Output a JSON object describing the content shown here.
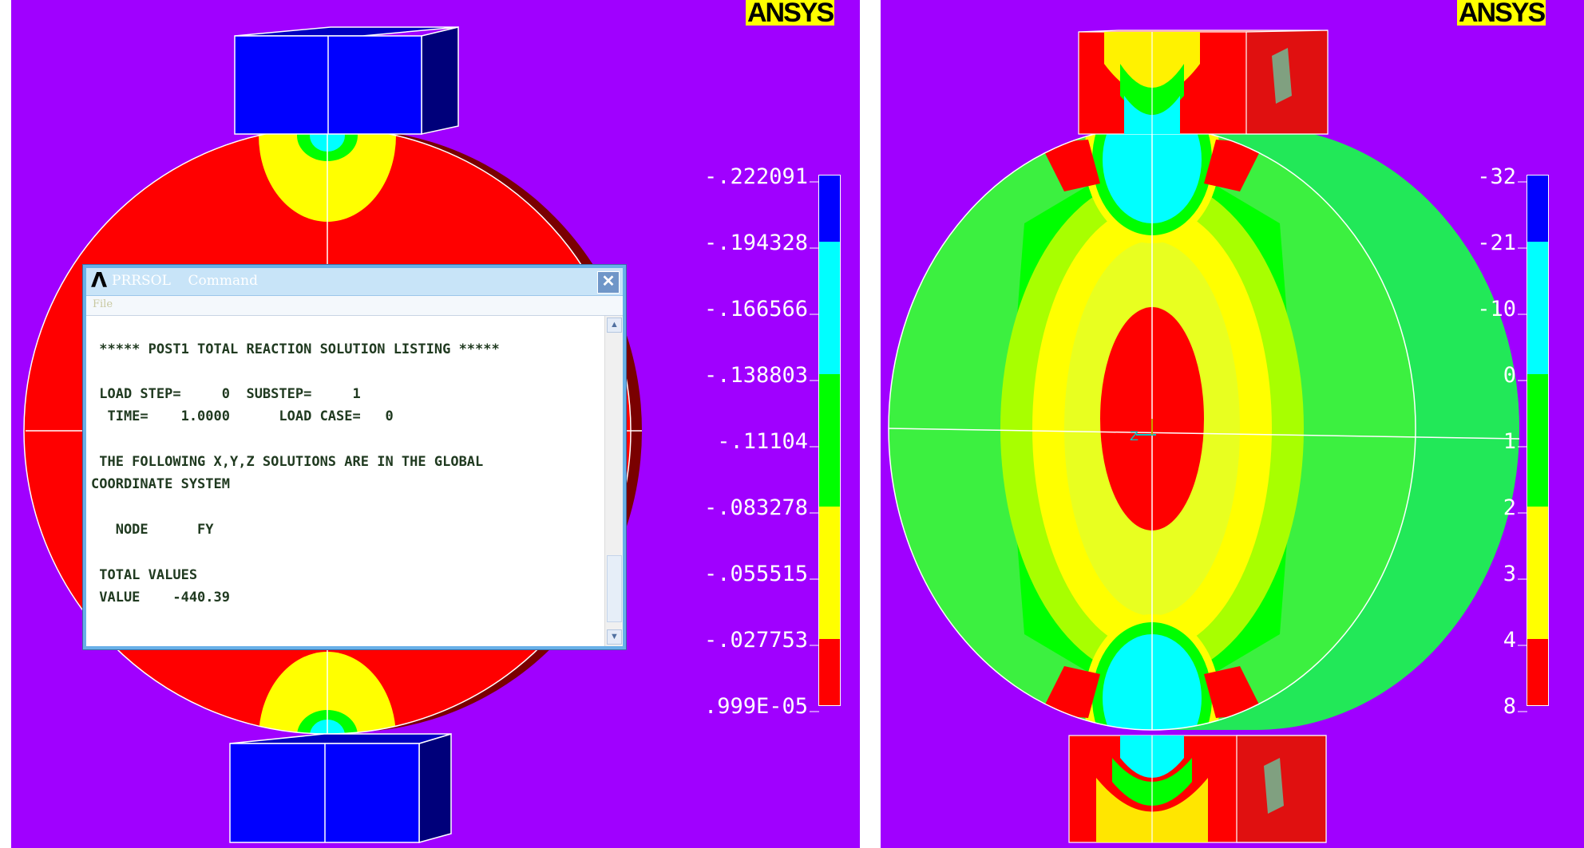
{
  "brand": {
    "logo_an": "AN",
    "logo_sys": "SYS"
  },
  "left_view": {
    "legend": {
      "labels": [
        "-.222091",
        "-.194328",
        "-.166566",
        "-.138803",
        "-.11104",
        "-.083278",
        "-.055515",
        "-.027753",
        ".999E-05"
      ],
      "colors": [
        "#0000ff",
        "#0000ff",
        "#00ffff",
        "#00ffff",
        "#00ff00",
        "#00ff00",
        "#ffff00",
        "#ffff00",
        "#ff0000"
      ]
    },
    "colors": {
      "background": "#a000ff",
      "body": "#ff0000",
      "contact_yellow": "#ffff00",
      "contact_green": "#00ff00",
      "contact_cyan": "#00ffff",
      "block_face": "#0000ff",
      "block_side": "#00007a",
      "rim": "#800000"
    }
  },
  "right_view": {
    "legend": {
      "labels": [
        "-32",
        "-21",
        "-10",
        "0",
        "1",
        "2",
        "3",
        "4",
        "8"
      ],
      "colors": [
        "#0000ff",
        "#0000ff",
        "#00ffff",
        "#00ffff",
        "#00ff00",
        "#00ff00",
        "#ffff00",
        "#ffff00",
        "#ff0000"
      ]
    },
    "triad_label": "Z"
  },
  "dialog": {
    "title": "PRRSOL    Command",
    "menu_file": "File",
    "lines": [
      " ***** POST1 TOTAL REACTION SOLUTION LISTING *****",
      " LOAD STEP=     0  SUBSTEP=     1",
      "  TIME=    1.0000      LOAD CASE=   0",
      " THE FOLLOWING X,Y,Z SOLUTIONS ARE IN THE GLOBAL",
      "COORDINATE SYSTEM",
      "   NODE      FY",
      " TOTAL VALUES",
      " VALUE    -440.39"
    ],
    "close_symbol": "✕",
    "scroll_up_symbol": "▲",
    "scroll_down_symbol": "▼"
  }
}
